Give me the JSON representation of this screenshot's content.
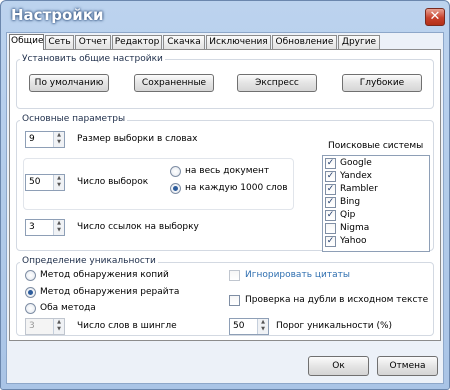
{
  "window": {
    "title": "Настройки"
  },
  "tabs": [
    "Общие",
    "Сеть",
    "Отчет",
    "Редактор",
    "Скачка",
    "Исключения",
    "Обновление",
    "Другие"
  ],
  "presets": {
    "label": "Установить общие настройки",
    "buttons": [
      "По умолчанию",
      "Сохраненные",
      "Экспресс",
      "Глубокие"
    ]
  },
  "main_params": {
    "label": "Основные параметры",
    "sample_size": {
      "value": "9",
      "label": "Размер выборки в словах"
    },
    "sample_count": {
      "value": "50",
      "label": "Число выборок"
    },
    "scope_options": [
      {
        "label": "на весь документ",
        "selected": false
      },
      {
        "label": "на каждую 1000 слов",
        "selected": true
      }
    ],
    "links_per_sample": {
      "value": "3",
      "label": "Число ссылок на выборку"
    }
  },
  "search_engines": {
    "label": "Поисковые системы",
    "items": [
      {
        "name": "Google",
        "checked": true
      },
      {
        "name": "Yandex",
        "checked": true
      },
      {
        "name": "Rambler",
        "checked": true
      },
      {
        "name": "Bing",
        "checked": true
      },
      {
        "name": "Qip",
        "checked": true
      },
      {
        "name": "Nigma",
        "checked": false
      },
      {
        "name": "Yahoo",
        "checked": true
      }
    ]
  },
  "uniqueness": {
    "label": "Определение уникальности",
    "methods": [
      {
        "label": "Метод обнаружения копий",
        "selected": false
      },
      {
        "label": "Метод обнаружения рерайта",
        "selected": true
      },
      {
        "label": "Оба метода",
        "selected": false
      }
    ],
    "shingle": {
      "value": "3",
      "label": "Число слов в шингле"
    },
    "ignore_quotes": {
      "label": "Игнорировать цитаты",
      "checked": false
    },
    "check_duplicates": {
      "label": "Проверка на дубли в исходном тексте",
      "checked": false
    },
    "threshold": {
      "value": "50",
      "label": "Порог уникальности (%)"
    }
  },
  "dialog": {
    "ok": "Ок",
    "cancel": "Отмена"
  },
  "colors": {
    "disabled_text": "#2f6fb0",
    "radio_dot": "#2d5c9c",
    "check_mark": "#1f3b6b"
  }
}
